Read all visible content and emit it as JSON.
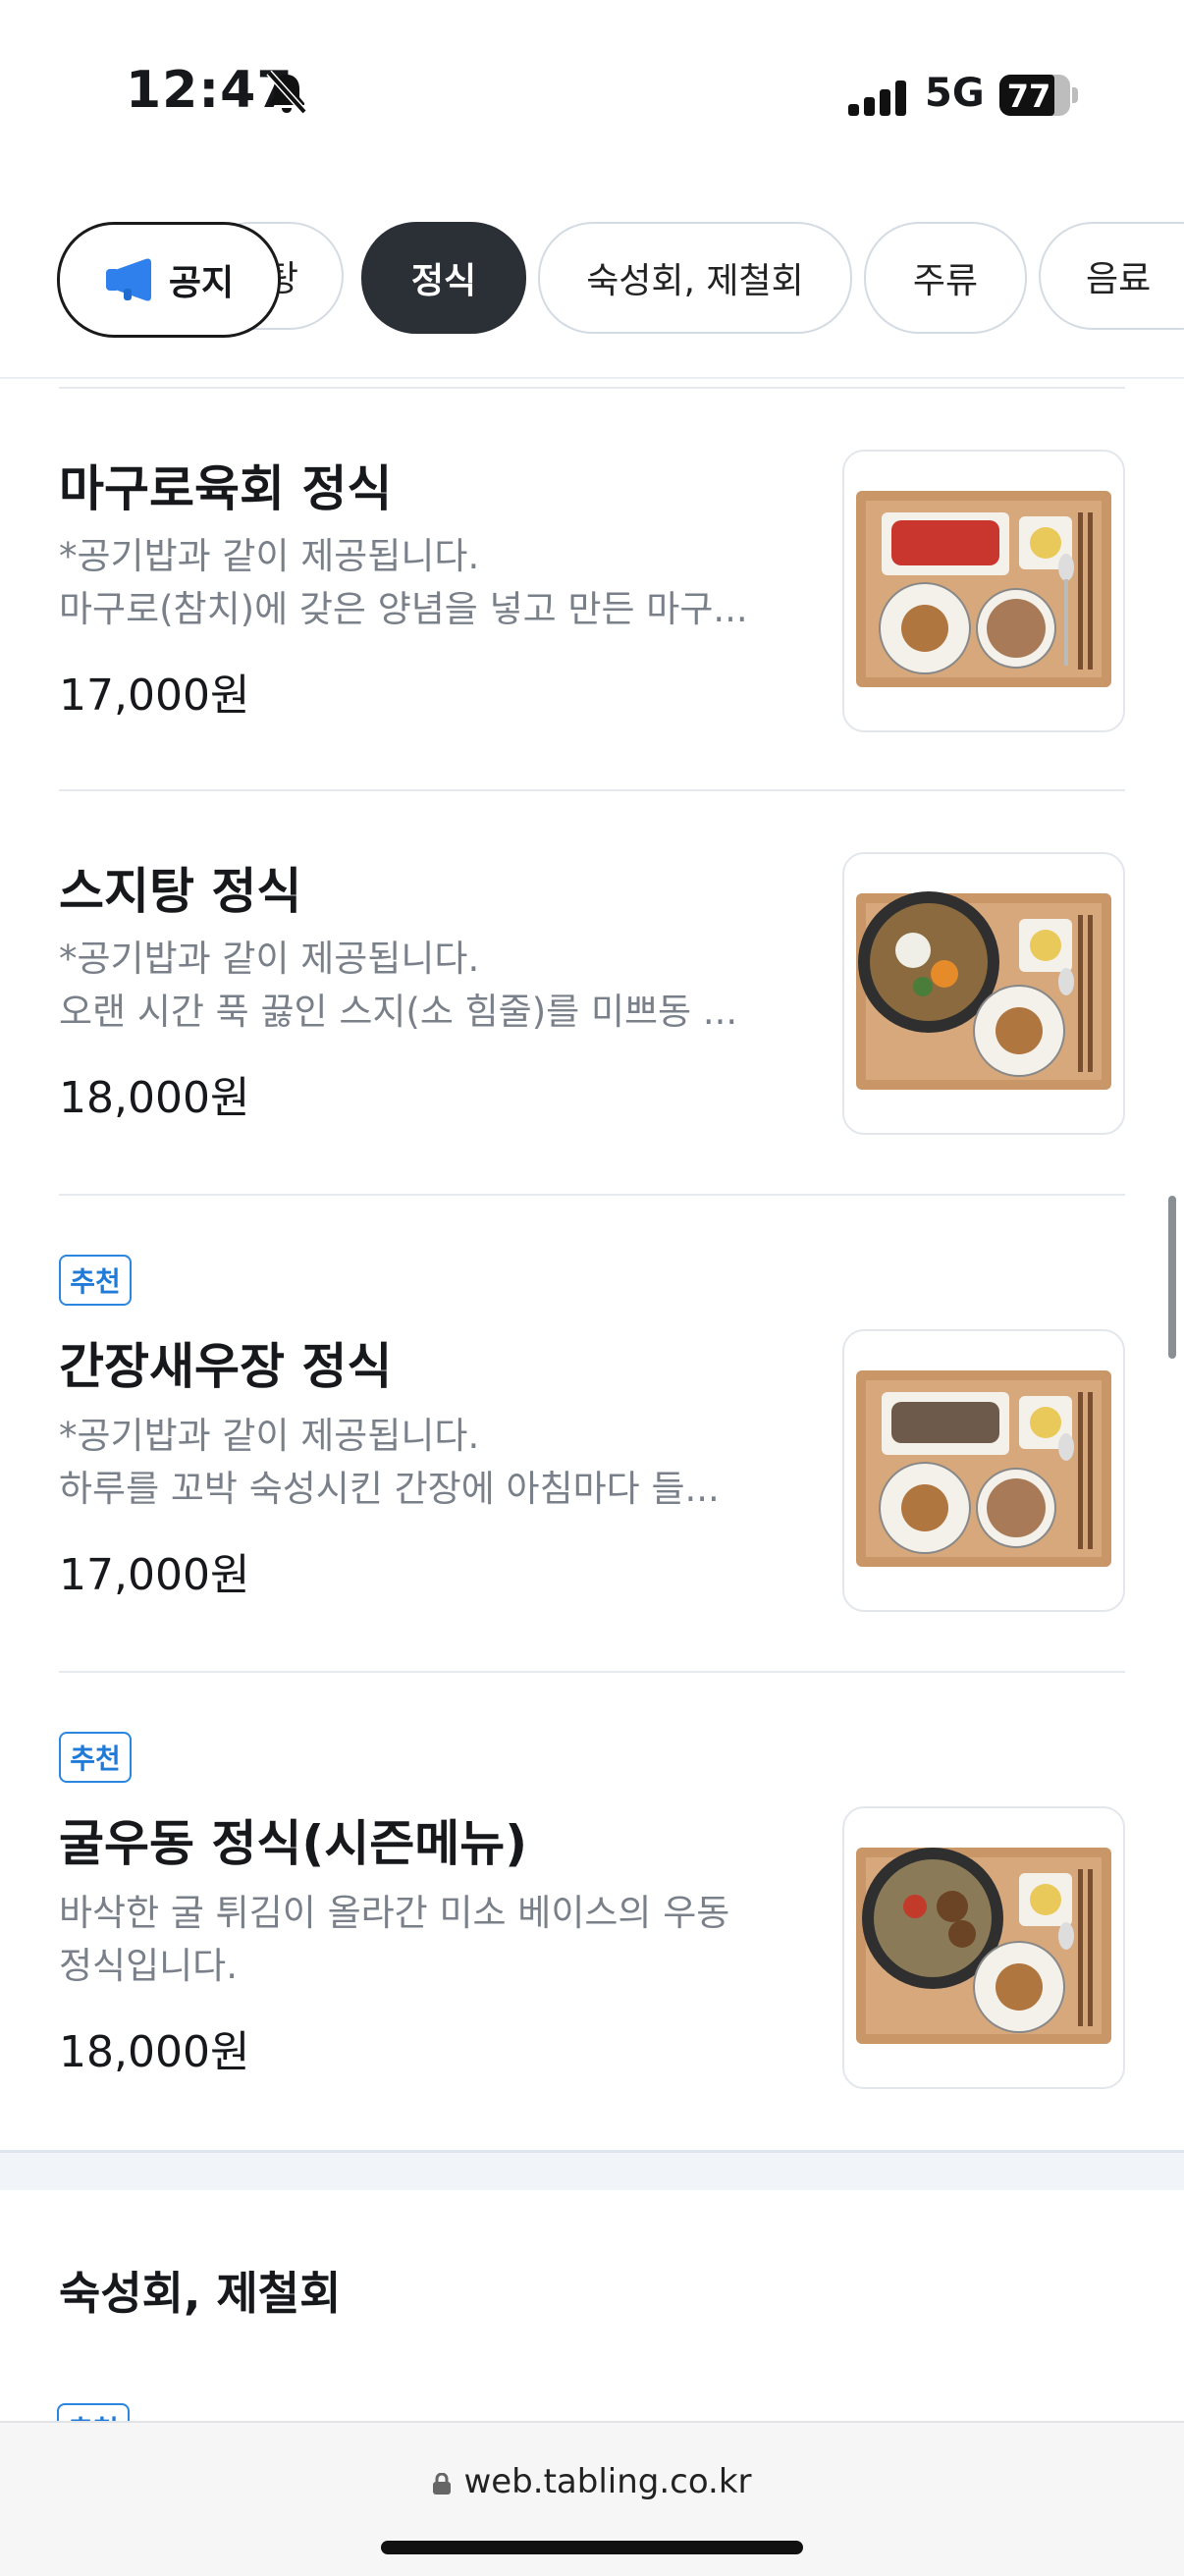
{
  "status_bar": {
    "time": "12:47",
    "network": "5G",
    "battery": "77"
  },
  "chips": {
    "notice": "공지",
    "partial": "탕",
    "items": [
      "정식",
      "숙성회, 제철회",
      "주류",
      "음료"
    ],
    "active": "정식"
  },
  "menu": [
    {
      "badge": "",
      "name": "마구로육회 정식",
      "desc": [
        "*공기밥과 같이 제공됩니다.",
        "마구로(참치)에 갖은 양념을 넣고 만든 마구..."
      ],
      "price": "17,000원",
      "image": "tuna-yukhoe-set"
    },
    {
      "badge": "",
      "name": "스지탕 정식",
      "desc": [
        "*공기밥과 같이 제공됩니다.",
        "오랜 시간 푹 끓인 스지(소 힘줄)를  미쁘동 ..."
      ],
      "price": "18,000원",
      "image": "suji-stew-set"
    },
    {
      "badge": "추천",
      "name": "간장새우장 정식",
      "desc": [
        "*공기밥과 같이 제공됩니다.",
        "하루를 꼬박 숙성시킨 간장에 아침마다 들..."
      ],
      "price": "17,000원",
      "image": "soy-shrimp-set"
    },
    {
      "badge": "추천",
      "name": "굴우동 정식(시즌메뉴)",
      "desc": [
        "바삭한 굴 튀김이 올라간 미소 베이스의 우동",
        "정식입니다."
      ],
      "price": "18,000원",
      "image": "oyster-udon-set"
    }
  ],
  "next_section": {
    "title": "숙성회, 제철회",
    "badge": "추천"
  },
  "browser": {
    "url": "web.tabling.co.kr"
  },
  "colors": {
    "accent_badge": "#1f7ad8",
    "active_chip": "#2b2f36",
    "notice_icon": "#2f80ed"
  }
}
